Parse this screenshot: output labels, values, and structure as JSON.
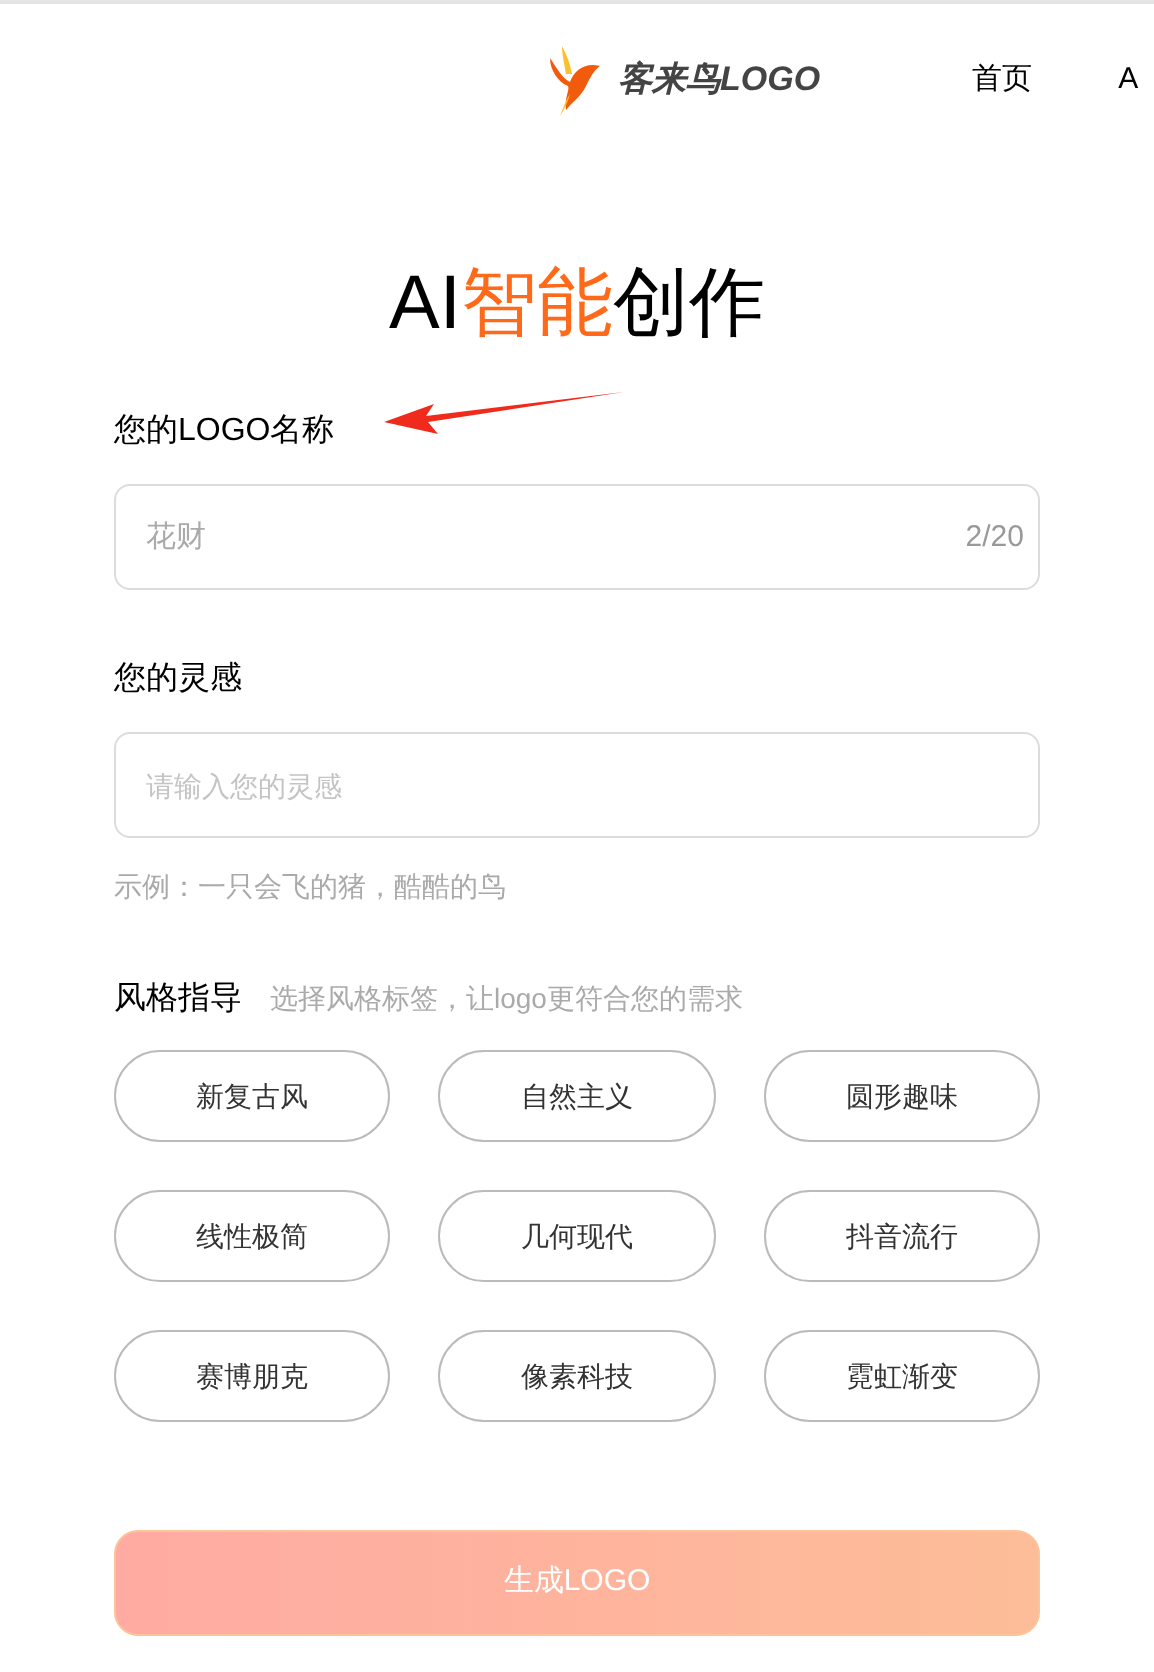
{
  "header": {
    "brand": "客来鸟LOGO",
    "nav": [
      {
        "label": "首页"
      },
      {
        "label": "A"
      }
    ]
  },
  "title": [
    {
      "text": "AI",
      "highlight": false
    },
    {
      "text": "智能",
      "highlight": true
    },
    {
      "text": "创作",
      "highlight": false
    }
  ],
  "name_field": {
    "label": "您的LOGO名称",
    "value": "花财",
    "counter": "2/20"
  },
  "inspiration_field": {
    "label": "您的灵感",
    "placeholder": "请输入您的灵感",
    "example": "示例：一只会飞的猪，酷酷的鸟"
  },
  "style": {
    "label": "风格指导",
    "hint": "选择风格标签，让logo更符合您的需求",
    "tags": [
      {
        "label": "新复古风",
        "selected": false
      },
      {
        "label": "自然主义",
        "selected": false
      },
      {
        "label": "圆形趣味",
        "selected": false
      },
      {
        "label": "线性极简",
        "selected": false
      },
      {
        "label": "几何现代",
        "selected": false
      },
      {
        "label": "抖音流行",
        "selected": false
      },
      {
        "label": "赛博朋克",
        "selected": false
      },
      {
        "label": "像素科技",
        "selected": false
      },
      {
        "label": "霓虹渐变",
        "selected": false
      }
    ]
  },
  "submit": {
    "label": "生成LOGO",
    "disabled": true
  }
}
